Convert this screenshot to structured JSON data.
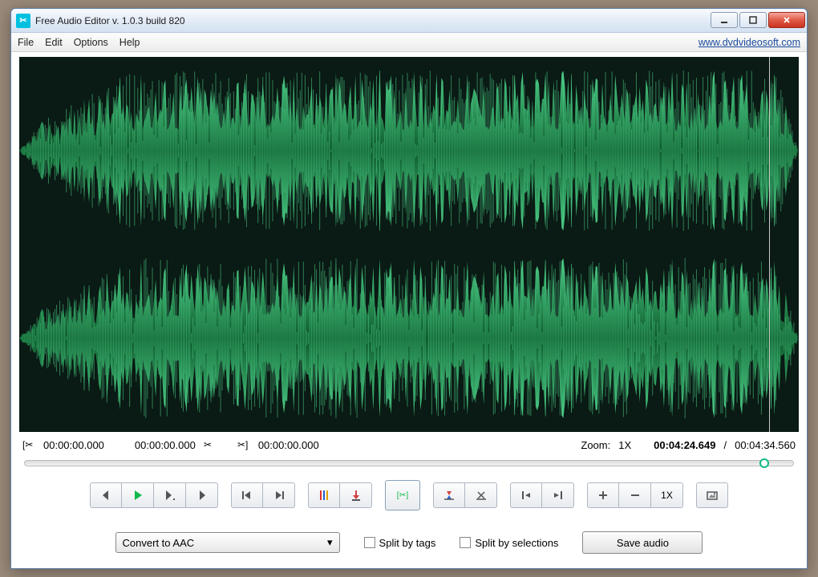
{
  "window": {
    "title": "Free Audio Editor v. 1.0.3 build 820"
  },
  "menubar": {
    "items": [
      "File",
      "Edit",
      "Options",
      "Help"
    ],
    "url": "www.dvdvideosoft.com"
  },
  "selection": {
    "start": "00:00:00.000",
    "end": "00:00:00.000",
    "cut": "00:00:00.000"
  },
  "playback": {
    "zoom_label": "Zoom:",
    "zoom_value": "1X",
    "position": "00:04:24.649",
    "divider": "/",
    "duration": "00:04:34.560",
    "progress_pct": 96.2
  },
  "toolbar": {
    "zoom_text": "1X"
  },
  "bottom": {
    "convert_label": "Convert to AAC",
    "split_tags": "Split by tags",
    "split_selections": "Split by selections",
    "save": "Save audio"
  },
  "colors": {
    "wave_light": "#4dd08a",
    "wave_dark": "#0d5a2a",
    "accent": "#12b886"
  }
}
